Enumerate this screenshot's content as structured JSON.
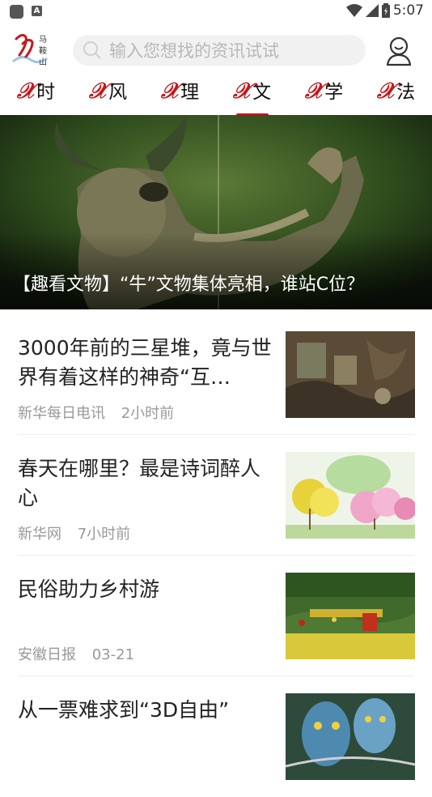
{
  "status_bar": {
    "time": "5:07",
    "notif_letter": "A"
  },
  "header": {
    "search_placeholder": "输入您想找的资讯试试"
  },
  "channels": [
    {
      "mark": "𝒳",
      "label": "时",
      "active": false
    },
    {
      "mark": "𝒳",
      "label": "风",
      "active": false
    },
    {
      "mark": "𝒳",
      "label": "理",
      "active": false
    },
    {
      "mark": "𝒳",
      "label": "文",
      "active": true
    },
    {
      "mark": "𝒳",
      "label": "学",
      "active": false
    },
    {
      "mark": "𝒳",
      "label": "法",
      "active": false
    }
  ],
  "banner": {
    "caption": "【趣看文物】“牛”文物集体亮相，谁站C位？"
  },
  "feed": [
    {
      "title": "3000年前的三星堆，竟与世界有着这样的神奇“互…",
      "source": "新华每日电讯",
      "time": "2小时前"
    },
    {
      "title": "春天在哪里？最是诗词醉人心",
      "source": "新华网",
      "time": "7小时前"
    },
    {
      "title": "民俗助力乡村游",
      "source": "安徽日报",
      "time": "03-21"
    },
    {
      "title": "从一票难求到“3D自由”",
      "source": "",
      "time": ""
    }
  ],
  "colors": {
    "accent": "#c8161d"
  }
}
